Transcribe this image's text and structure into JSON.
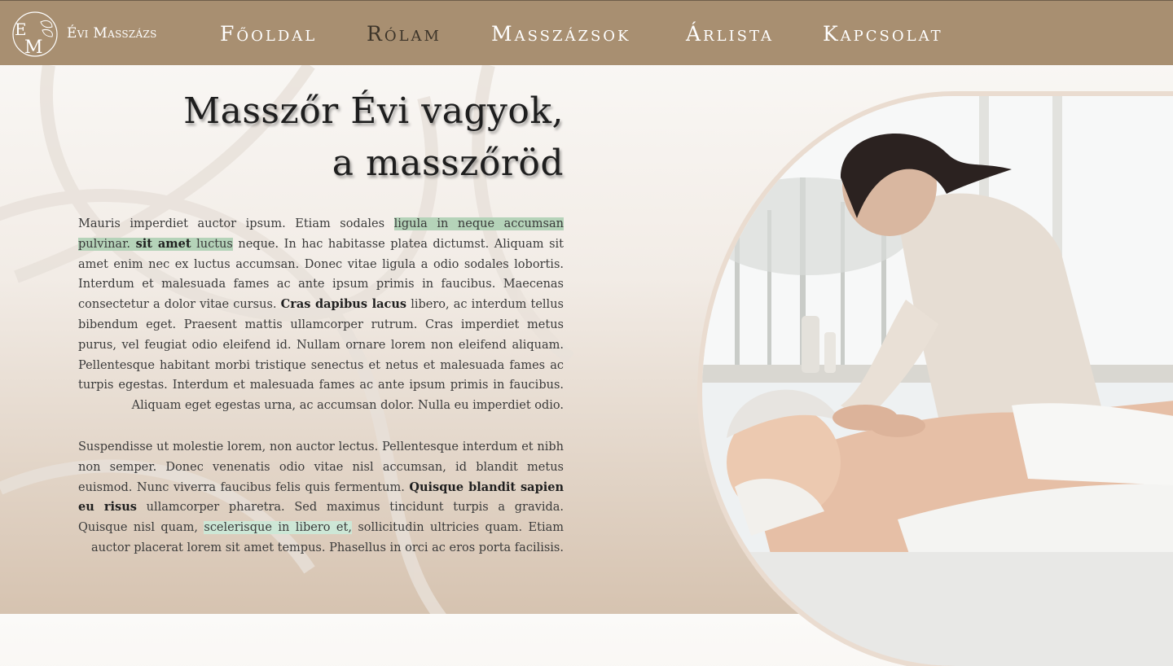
{
  "header": {
    "brand": "Évi Masszázs",
    "logo_icon": "em-monogram-leaf-icon",
    "nav": [
      {
        "label": "Főoldal",
        "active": false
      },
      {
        "label": "Rólam",
        "active": true
      },
      {
        "label": "Masszázsok",
        "active": false
      },
      {
        "label": "Árlista",
        "active": false
      },
      {
        "label": "Kapcsolat",
        "active": false
      }
    ]
  },
  "main": {
    "title_line1": "Masszőr Évi vagyok,",
    "title_line2": "a masszőröd",
    "p1": {
      "t1": "Mauris imperdiet auctor ipsum. Etiam sodales ",
      "hl1": "ligula in neque accumsan pulvinar. ",
      "hl1_bold": "sit amet",
      "hl1_end": " luctus",
      "t2": " neque. In hac habitasse platea dictumst. Aliquam sit amet enim nec ex luctus accumsan. Donec vitae ligula a odio sodales lobortis. Interdum et malesuada fames ac ante ipsum primis in faucibus. Maecenas consectetur a dolor vitae cursus. ",
      "b1": "Cras dapibus lacus",
      "t3": " libero, ac interdum tellus bibendum eget. Praesent mattis ullamcorper rutrum. Cras imperdiet metus purus, vel feugiat odio eleifend id. Nullam ornare lorem non eleifend aliquam. Pellentesque habitant morbi tristique senectus et netus et malesuada fames ac turpis egestas. Interdum et malesuada fames ac ante ipsum primis in faucibus. Aliquam eget egestas urna, ac accumsan dolor. Nulla eu imperdiet odio."
    },
    "p2": {
      "t1": "Suspendisse ut molestie lorem, non auctor lectus. Pellentesque interdum et nibh non semper. Donec venenatis odio vitae nisl accumsan, id blandit metus euismod. Nunc viverra faucibus felis quis fermentum. ",
      "b1": "Quisque blandit sapien eu risus",
      "t2": " ullamcorper pharetra. Sed maximus tincidunt turpis a gravida. Quisque nisl quam, ",
      "hl1": "scelerisque in libero et,",
      "t3": " sollicitudin ultricies quam. Etiam auctor placerat lorem sit amet tempus. Phasellus in orci ac eros porta facilisis."
    },
    "highlight_color": "#b5d3b9",
    "header_color": "#a88f71"
  }
}
